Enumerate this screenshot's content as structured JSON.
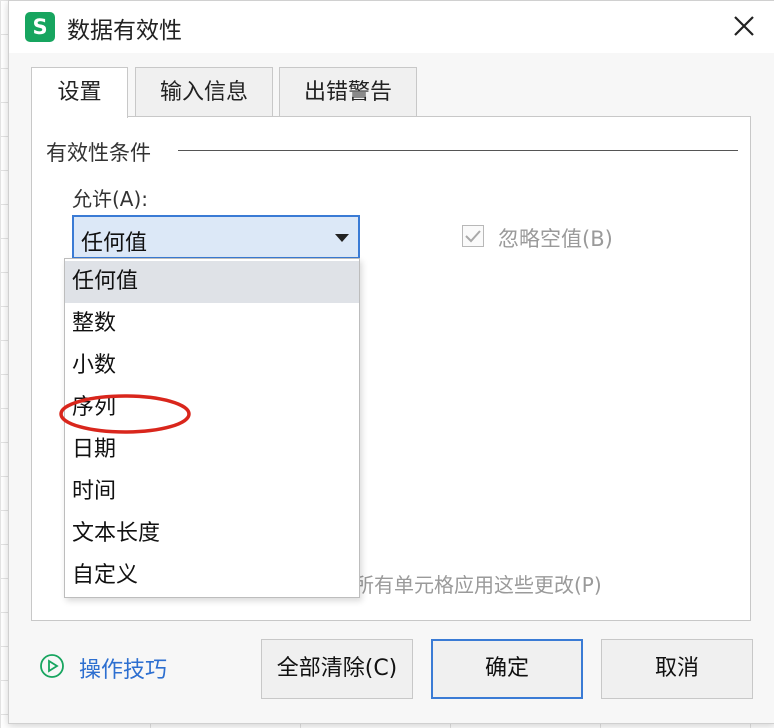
{
  "dialog": {
    "app_icon_letter": "S",
    "title": "数据有效性",
    "tabs": [
      {
        "label": "设置",
        "active": true
      },
      {
        "label": "输入信息",
        "active": false
      },
      {
        "label": "出错警告",
        "active": false
      }
    ]
  },
  "settings": {
    "group_title": "有效性条件",
    "allow_label": "允许(A):",
    "allow_value": "任何值",
    "ignore_blank_label": "忽略空值(B)",
    "ignore_blank_checked": true,
    "apply_all_label": "所有单元格应用这些更改(P)",
    "dropdown_options": [
      "任何值",
      "整数",
      "小数",
      "序列",
      "日期",
      "时间",
      "文本长度",
      "自定义"
    ],
    "selected_option": "任何值",
    "highlighted_option": "序列"
  },
  "footer": {
    "tips_label": "操作技巧",
    "clear_all_label": "全部清除(C)",
    "ok_label": "确定",
    "cancel_label": "取消"
  },
  "colors": {
    "brand_green": "#17a55f",
    "accent_blue": "#3a7bd5",
    "link_blue": "#2d6fd0",
    "annotation_red": "#d9261c"
  }
}
